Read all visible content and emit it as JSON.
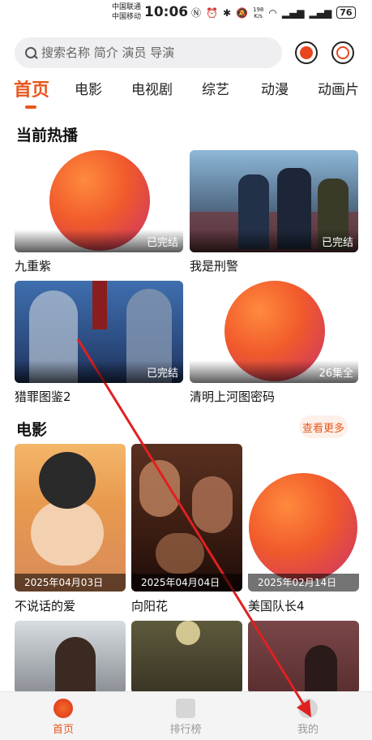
{
  "status": {
    "carrier1": "中国联通",
    "carrier2": "中国移动",
    "time": "10:06",
    "netspeed_value": "198",
    "netspeed_unit": "K/s",
    "battery": "76"
  },
  "search": {
    "placeholder": "搜索名称 简介 演员 导演"
  },
  "tabs": [
    "首页",
    "电影",
    "电视剧",
    "综艺",
    "动漫",
    "动画片"
  ],
  "hot": {
    "title": "当前热播",
    "items": [
      {
        "title": "九重紫",
        "badge": "已完结"
      },
      {
        "title": "我是刑警",
        "badge": "已完结"
      },
      {
        "title": "猎罪图鉴2",
        "badge": "已完结"
      },
      {
        "title": "清明上河图密码",
        "badge": "26集全"
      }
    ]
  },
  "movies": {
    "title": "电影",
    "more": "查看更多",
    "items": [
      {
        "title": "不说话的爱",
        "date": "2025年04月03日"
      },
      {
        "title": "向阳花",
        "date": "2025年04月04日"
      },
      {
        "title": "美国队长4",
        "date": "2025年02月14日"
      }
    ]
  },
  "nav": {
    "home": "首页",
    "rank": "排行榜",
    "mine": "我的"
  },
  "colors": {
    "accent": "#e8571e"
  }
}
